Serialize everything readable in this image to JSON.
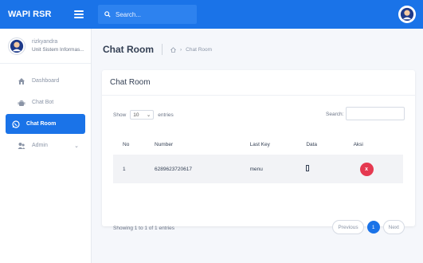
{
  "brand": {
    "name": "WAPI RSR"
  },
  "search": {
    "placeholder": "Search..."
  },
  "user": {
    "name": "rizkyandra",
    "unit": "Unit Sistem Informas..."
  },
  "sidebar": {
    "items": [
      {
        "label": "Dashboard",
        "icon": "home-icon"
      },
      {
        "label": "Chat Bot",
        "icon": "android-icon"
      },
      {
        "label": "Chat Room",
        "icon": "whatsapp-icon"
      },
      {
        "label": "Admin",
        "icon": "users-icon"
      }
    ]
  },
  "page": {
    "title": "Chat Room"
  },
  "breadcrumb": {
    "current": "Chat Room"
  },
  "card": {
    "title": "Chat Room"
  },
  "table_controls": {
    "show_label": "Show",
    "entries_value": "10",
    "entries_label": "entries",
    "search_label": "Search:"
  },
  "table": {
    "columns": [
      "No",
      "Number",
      "Last Key",
      "Data",
      "Aksi"
    ],
    "rows": [
      {
        "no": "1",
        "number": "6289623720617",
        "last_key": "menu",
        "delete_label": "x"
      }
    ]
  },
  "footer": {
    "showing": "Showing 1 to 1 of 1 entries"
  },
  "pagination": {
    "previous": "Previous",
    "current": "1",
    "next": "Next"
  },
  "colors": {
    "primary": "#1a73e8",
    "danger": "#e53950"
  }
}
